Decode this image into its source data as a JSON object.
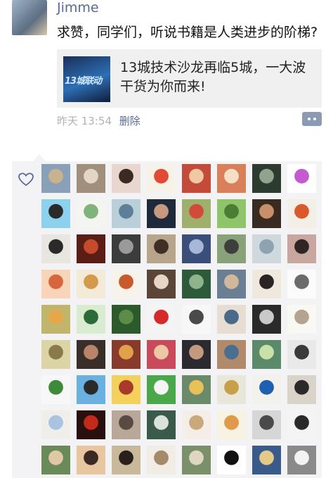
{
  "post": {
    "username": "Jimme",
    "text": "求赞，同学们，听说书籍是人类进步的阶梯?",
    "link": {
      "title": "13城技术沙龙再临5城，一大波干货为你而来!",
      "thumb_text": "13城联动"
    },
    "time": "昨天 13:54",
    "delete_label": "删除"
  },
  "colors": {
    "name_blue": "#576b95",
    "panel_bg": "#f3f3f5",
    "link_card_bg": "#f0f0f0",
    "meta_gray": "#b2b2b2"
  },
  "likes": {
    "icon": "heart-icon",
    "avatars": [
      {
        "colors": [
          "#8aa0b8",
          "#c9b38f"
        ]
      },
      {
        "colors": [
          "#a08f7a",
          "#e2d6c6"
        ]
      },
      {
        "colors": [
          "#e8d6cf",
          "#3b2a24"
        ]
      },
      {
        "colors": [
          "#f7f2e8",
          "#e24a36"
        ]
      },
      {
        "colors": [
          "#c44a3a",
          "#f0c9a4"
        ]
      },
      {
        "colors": [
          "#d97f5a",
          "#f5e0c6"
        ]
      },
      {
        "colors": [
          "#2d3a2f",
          "#8fa38e"
        ]
      },
      {
        "colors": [
          "#ffffff",
          "#c45bd1"
        ]
      },
      {
        "colors": [
          "#8dd2ec",
          "#2a2a2a"
        ]
      },
      {
        "colors": [
          "#f4f4f0",
          "#7fb37a"
        ]
      },
      {
        "colors": [
          "#b9cfd9",
          "#5f7f99"
        ]
      },
      {
        "colors": [
          "#1e2a3b",
          "#c79a7f"
        ]
      },
      {
        "colors": [
          "#9fb06c",
          "#d14a3a"
        ]
      },
      {
        "colors": [
          "#8fc46a",
          "#4d7c34"
        ]
      },
      {
        "colors": [
          "#3a2b22",
          "#c98f6a"
        ]
      },
      {
        "colors": [
          "#f3efe6",
          "#d9582c"
        ]
      },
      {
        "colors": [
          "#e9e5e1",
          "#2a2a2a"
        ]
      },
      {
        "colors": [
          "#5a1e16",
          "#c64a2c"
        ]
      },
      {
        "colors": [
          "#3c3c3c",
          "#9a9a9a"
        ]
      },
      {
        "colors": [
          "#b7a48a",
          "#3d2f24"
        ]
      },
      {
        "colors": [
          "#3b4e7a",
          "#a7b7d9"
        ]
      },
      {
        "colors": [
          "#8aa27a",
          "#3e3e3e"
        ]
      },
      {
        "colors": [
          "#cfd8dc",
          "#8ea3b0"
        ]
      },
      {
        "colors": [
          "#c7a7a0",
          "#2f2524"
        ]
      },
      {
        "colors": [
          "#f8d5b9",
          "#d7663e"
        ]
      },
      {
        "colors": [
          "#f3ead8",
          "#d49a4c"
        ]
      },
      {
        "colors": [
          "#f7f3ea",
          "#c85a2c"
        ]
      },
      {
        "colors": [
          "#5a4536",
          "#e6d6c6"
        ]
      },
      {
        "colors": [
          "#2c5a3a",
          "#8fb38a"
        ]
      },
      {
        "colors": [
          "#6a7f93",
          "#d2b89a"
        ]
      },
      {
        "colors": [
          "#efe8de",
          "#2a2524"
        ]
      },
      {
        "colors": [
          "#fbfbfb",
          "#6b6b6b"
        ]
      },
      {
        "colors": [
          "#c0b56a",
          "#e6a74a"
        ]
      },
      {
        "colors": [
          "#d9ecd0",
          "#2c6a3a"
        ]
      },
      {
        "colors": [
          "#2d5a2c",
          "#5d8c4a"
        ]
      },
      {
        "colors": [
          "#f4f4f4",
          "#d42a2a"
        ]
      },
      {
        "colors": [
          "#f7f7f7",
          "#4a4a4a"
        ]
      },
      {
        "colors": [
          "#e7ddd2",
          "#4a6a8a"
        ]
      },
      {
        "colors": [
          "#2a2a2a",
          "#c9c9c9"
        ]
      },
      {
        "colors": [
          "#faf8f2",
          "#b4a48f"
        ]
      },
      {
        "colors": [
          "#dcd3a6",
          "#8a7a4a"
        ]
      },
      {
        "colors": [
          "#3a2e28",
          "#b9856a"
        ]
      },
      {
        "colors": [
          "#8a3a2a",
          "#e0a14a"
        ]
      },
      {
        "colors": [
          "#c94a5a",
          "#f0c7a6"
        ]
      },
      {
        "colors": [
          "#2b2a30",
          "#c49a7f"
        ]
      },
      {
        "colors": [
          "#b08a6a",
          "#4a6e8f"
        ]
      },
      {
        "colors": [
          "#5a8a6a",
          "#c9e0a8"
        ]
      },
      {
        "colors": [
          "#e9e9e9",
          "#3a3a3a"
        ]
      },
      {
        "colors": [
          "#f7f7f7",
          "#3d8a3a"
        ]
      },
      {
        "colors": [
          "#6ab0e0",
          "#2a2a2a"
        ]
      },
      {
        "colors": [
          "#f3d15a",
          "#a83a2a"
        ]
      },
      {
        "colors": [
          "#4aa84a",
          "#f5f5f5"
        ]
      },
      {
        "colors": [
          "#6a8a6a",
          "#e8c15a"
        ]
      },
      {
        "colors": [
          "#e9e6da",
          "#c9a04a"
        ]
      },
      {
        "colors": [
          "#f3f1ec",
          "#1f5fb0"
        ]
      },
      {
        "colors": [
          "#d9d3c9",
          "#2a2a2a"
        ]
      },
      {
        "colors": [
          "#f0eeea",
          "#a8c4e0"
        ]
      },
      {
        "colors": [
          "#2a0f0f",
          "#c42a1a"
        ]
      },
      {
        "colors": [
          "#b9a79a",
          "#5a4a44"
        ]
      },
      {
        "colors": [
          "#3a5a4a",
          "#d9e3dc"
        ]
      },
      {
        "colors": [
          "#f5eee8",
          "#c9a87a"
        ]
      },
      {
        "colors": [
          "#f7f2e2",
          "#e09a4a"
        ]
      },
      {
        "colors": [
          "#d6d6d6",
          "#4a4a4a"
        ]
      },
      {
        "colors": [
          "#f4f4f4",
          "#2a2a2a"
        ]
      },
      {
        "colors": [
          "#6b8a5a",
          "#e0c7a6"
        ]
      },
      {
        "colors": [
          "#e8c7a0",
          "#3a2a24"
        ]
      },
      {
        "colors": [
          "#c9b89a",
          "#2a1f1a"
        ]
      },
      {
        "colors": [
          "#f2ede4",
          "#a58a6a"
        ]
      },
      {
        "colors": [
          "#7a8f6a",
          "#e0d6c0"
        ]
      },
      {
        "colors": [
          "#ffffff",
          "#111111"
        ]
      },
      {
        "colors": [
          "#3a5a8a",
          "#e3c98a"
        ]
      },
      {
        "colors": [
          "#8a8a8a",
          "#f3f3f3"
        ]
      }
    ]
  }
}
